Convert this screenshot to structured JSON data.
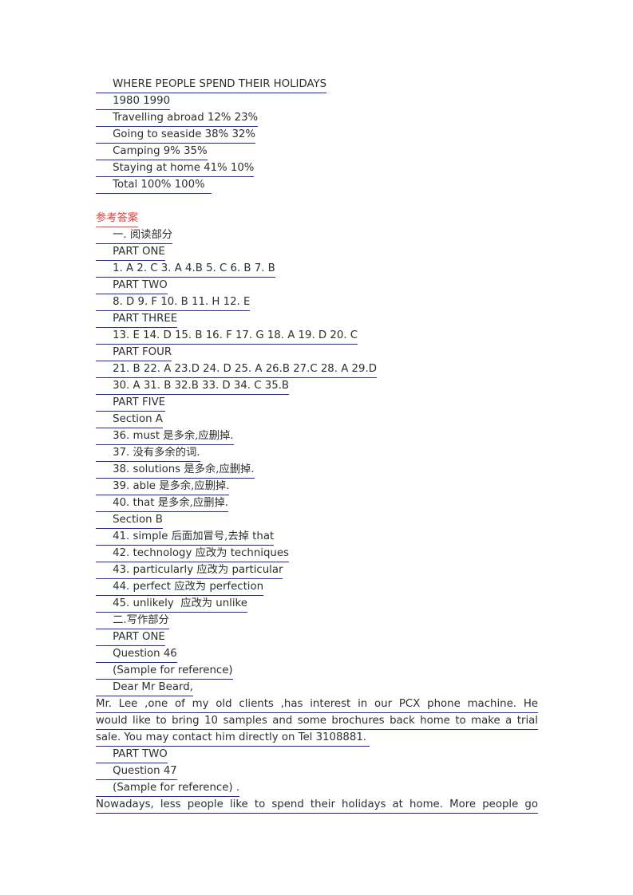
{
  "document": {
    "table_block": {
      "title": "WHERE PEOPLE SPEND THEIR HOLIDAYS",
      "years_row": "1980 1990",
      "rows": [
        "Travelling abroad 12% 23%",
        "Going to seaside 38% 32%",
        "Camping 9% 35%",
        "Staying at home 41% 10%",
        "Total 100% 100%  "
      ]
    },
    "answer_key_heading": "参考答案",
    "section_one_heading": "一. 阅读部分",
    "reading": {
      "part_one_label": "PART ONE",
      "part_one_answers": "1. A 2. C 3. A 4.B 5. C 6. B 7. B",
      "part_two_label": "PART TWO",
      "part_two_answers": "8. D 9. F 10. B 11. H 12. E",
      "part_three_label": "PART THREE",
      "part_three_answers": "13. E 14. D 15. B 16. F 17. G 18. A 19. D 20. C",
      "part_four_label": "PART FOUR",
      "part_four_answers_line1": "21. B 22. A 23.D 24. D 25. A 26.B 27.C 28. A 29.D",
      "part_four_answers_line2": "30. A 31. B 32.B 33. D 34. C 35.B",
      "part_five_label": "PART FIVE",
      "section_a_label": "Section A",
      "section_a_items": [
        {
          "num": "36. ",
          "word": "must ",
          "note": "是多余,应删掉."
        },
        {
          "num": "37. ",
          "word": "",
          "note": "没有多余的词."
        },
        {
          "num": "38. ",
          "word": "solutions ",
          "note": "是多余,应删掉."
        },
        {
          "num": "39. ",
          "word": "able ",
          "note": "是多余,应删掉."
        },
        {
          "num": "40. ",
          "word": "that ",
          "note": "是多余,应删掉."
        }
      ],
      "section_b_label": "Section B",
      "section_b_items": [
        {
          "num": "41. ",
          "word": "simple ",
          "note": "后面加冒号,去掉",
          "tail": " that"
        },
        {
          "num": "42. ",
          "word": "technology ",
          "note": "应改为",
          "tail": " techniques"
        },
        {
          "num": "43. ",
          "word": "particularly ",
          "note": "应改为",
          "tail": " particular"
        },
        {
          "num": "44. ",
          "word": "perfect ",
          "note": "应改为",
          "tail": " perfection"
        },
        {
          "num": "45. ",
          "word": "unlikely  ",
          "note": "应改为",
          "tail": " unlike"
        }
      ]
    },
    "section_two_heading": "二.写作部分",
    "writing": {
      "part_one_label": "PART ONE",
      "question_46": "Question 46",
      "sample_note_46": "(Sample for reference)",
      "salutation": "Dear Mr Beard,",
      "letter_line_1": "Mr. Lee ,one of my old clients ,has interest in our PCX phone machine. He",
      "letter_line_2": "would like to bring 10 samples and some brochures back home to make a trial",
      "letter_line_3": "sale. You may contact him directly on Tel 3108881. ",
      "part_two_label": "PART TWO",
      "question_47": "Question 47",
      "sample_note_47": "(Sample for reference) .",
      "essay_line_1": "Nowadays, less people like to spend their holidays at home. More people go"
    }
  },
  "indent": {
    "tab": "     ",
    "tab_small": "    "
  },
  "colors": {
    "text": "#2e2e2e",
    "underline_blue": "#2222cc",
    "heading_red": "#e8413c",
    "page_background": "#ffffff"
  }
}
